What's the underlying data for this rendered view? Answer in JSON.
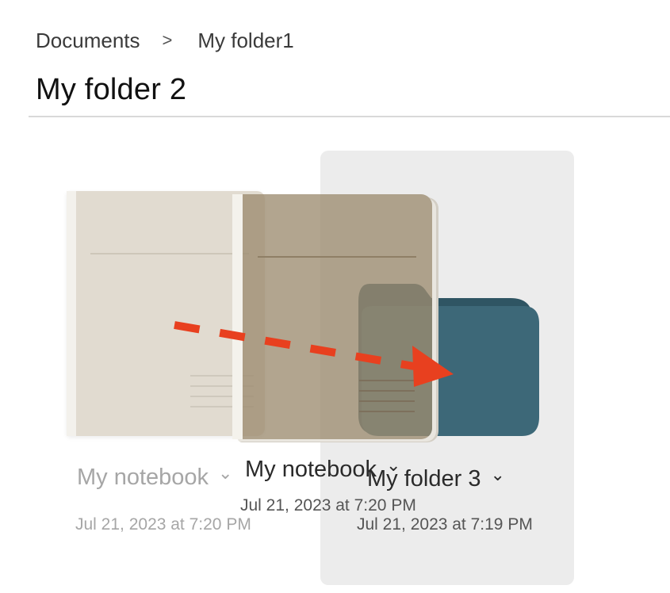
{
  "breadcrumb": {
    "root": "Documents",
    "separator": ">",
    "current": "My folder1"
  },
  "page": {
    "title": "My folder 2"
  },
  "items": {
    "notebook": {
      "name": "My notebook",
      "date": "Jul 21, 2023 at 7:20 PM",
      "chevron": "⌄"
    },
    "dragged": {
      "name": "My notebook",
      "date": "Jul 21, 2023 at 7:20 PM",
      "chevron": "⌄"
    },
    "folder": {
      "name": "My folder 3",
      "date": "Jul 21, 2023 at 7:19 PM",
      "chevron": "⌄"
    }
  },
  "colors": {
    "folder": "#3d6878",
    "folder_dark": "#2f5563",
    "drop_highlight": "#ececec",
    "arrow": "#e8401f",
    "notebook_cover": "#e1dbd0",
    "notebook_drag": "#9c8c70"
  },
  "icons": {
    "chevron": "chevron-down-icon",
    "separator": "chevron-right-icon"
  }
}
